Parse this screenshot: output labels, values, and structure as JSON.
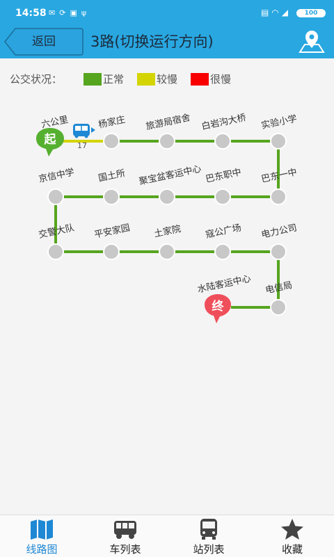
{
  "status_bar": {
    "time": "14:58",
    "battery": "100",
    "notification_icons": [
      "mail-icon",
      "sync-icon",
      "app-icon",
      "usb-icon"
    ],
    "system_icons": [
      "nfc-icon",
      "wifi-icon",
      "signal-icon"
    ]
  },
  "header": {
    "back_label": "返回",
    "title": "3路(切换运行方向)",
    "map_icon": "map-pin-icon"
  },
  "legend": {
    "title": "公交状况：",
    "items": [
      {
        "label": "正常",
        "color": "#56a51e"
      },
      {
        "label": "较慢",
        "color": "#d4d400"
      },
      {
        "label": "很慢",
        "color": "#f80000"
      }
    ]
  },
  "route": {
    "start_badge": "起",
    "end_badge": "终",
    "bus_count": "17",
    "colors": {
      "normal": "#56a51e",
      "slow": "#d4d400",
      "stop": "#c8c8c8",
      "start": "#56b030",
      "end": "#ef4f5b"
    },
    "stops": [
      "六公里",
      "杨家庄",
      "旅游局宿舍",
      "白岩沟大桥",
      "实验小学",
      "巴东一中",
      "巴东职中",
      "聚宝盆客运中心",
      "国土所",
      "京信中学",
      "交警大队",
      "平安家园",
      "土家院",
      "寇公广场",
      "电力公司",
      "电信局",
      "水陆客运中心"
    ]
  },
  "bottom_nav": [
    {
      "label": "线路图",
      "icon": "map-icon",
      "active": true
    },
    {
      "label": "车列表",
      "icon": "bus-icon",
      "active": false
    },
    {
      "label": "站列表",
      "icon": "bus-stop-icon",
      "active": false
    },
    {
      "label": "收藏",
      "icon": "star-icon",
      "active": false
    }
  ]
}
